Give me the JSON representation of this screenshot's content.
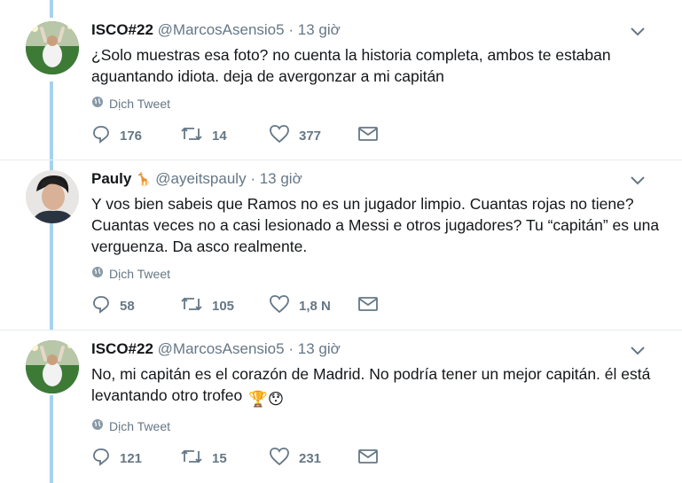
{
  "tweets": [
    {
      "name": "ISCO#22",
      "handle": "@MarcosAsensio5",
      "sep": "·",
      "time": "13 giờ",
      "text": "¿Solo muestras esa foto? no cuenta la historia completa, ambos te estaban aguantando idiota. deja de avergonzar a mi capitán",
      "translate": "Dịch Tweet",
      "replies": "176",
      "retweets": "14",
      "likes": "377"
    },
    {
      "name": "Pauly",
      "name_badge": "🦒",
      "handle": "@ayeitspauly",
      "sep": "·",
      "time": "13 giờ",
      "text": "Y vos bien sabeis que Ramos no es un jugador limpio. Cuantas rojas no tiene? Cuantas veces no a casi lesionado a Messi e otros jugadores? Tu “capitán” es una verguenza. Da asco realmente.",
      "translate": "Dịch Tweet",
      "replies": "58",
      "retweets": "105",
      "likes": "1,8 N"
    },
    {
      "name": "ISCO#22",
      "handle": "@MarcosAsensio5",
      "sep": "·",
      "time": "13 giờ",
      "text": "No, mi capitán es el corazón de Madrid. No podría tener un mejor capitán. él está levantando otro trofeo",
      "emojis": "🏆😯",
      "translate": "Dịch Tweet",
      "replies": "121",
      "retweets": "15",
      "likes": "231"
    }
  ],
  "colors": {
    "thread": "#a6d2ef",
    "muted": "#657786",
    "text": "#14171a"
  },
  "icons": [
    "reply-icon",
    "retweet-icon",
    "like-icon",
    "dm-icon",
    "globe-icon",
    "caret-down-icon"
  ]
}
